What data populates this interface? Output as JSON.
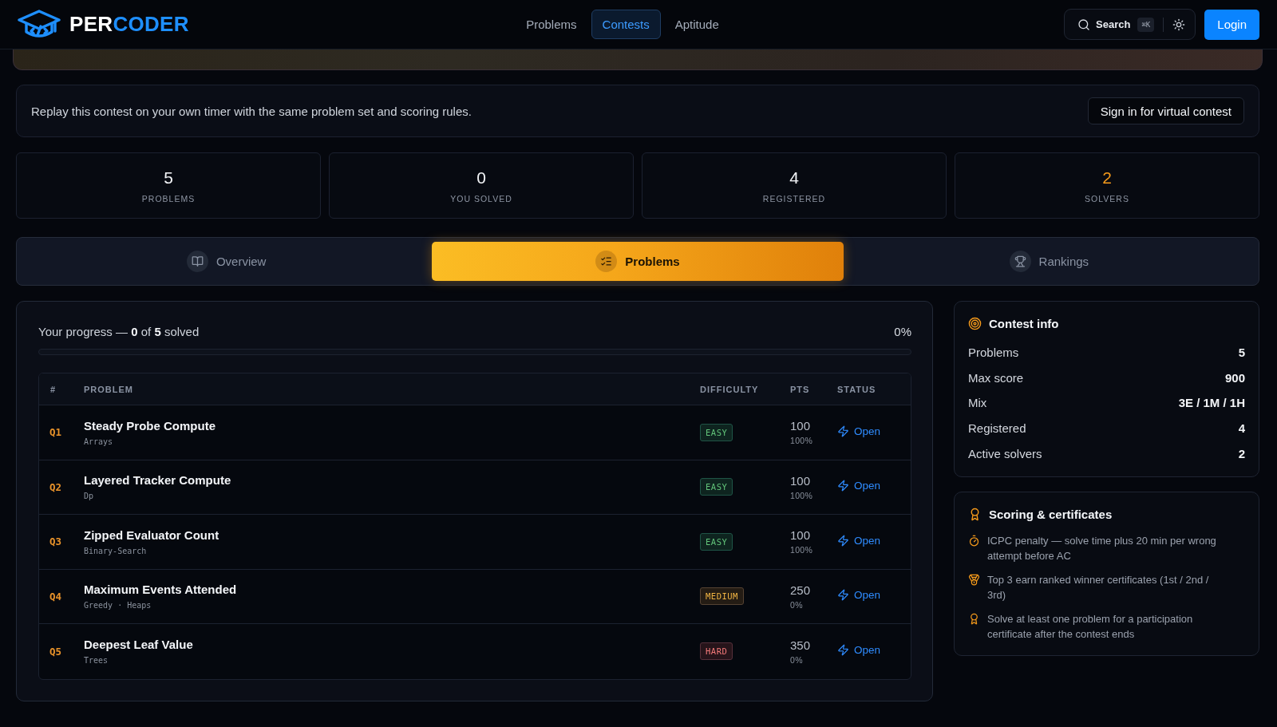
{
  "nav": {
    "logo": {
      "lead": "PER",
      "accent": "CODER"
    },
    "links": [
      {
        "label": "Problems",
        "selected": false
      },
      {
        "label": "Contests",
        "selected": true
      },
      {
        "label": "Aptitude",
        "selected": false
      }
    ],
    "search": {
      "label": "Search",
      "shortcut": "⌘K"
    },
    "login": "Login"
  },
  "virtual_contest": {
    "text": "Replay this contest on your own timer with the same problem set and scoring rules.",
    "button": "Sign in for virtual contest"
  },
  "stats": [
    {
      "value": "5",
      "label": "PROBLEMS",
      "highlighted": false
    },
    {
      "value": "0",
      "label": "YOU SOLVED",
      "highlighted": false
    },
    {
      "value": "4",
      "label": "REGISTERED",
      "highlighted": false
    },
    {
      "value": "2",
      "label": "SOLVERS",
      "highlighted": true
    }
  ],
  "tabs": [
    {
      "label": "Overview",
      "selected": false
    },
    {
      "label": "Problems",
      "selected": true
    },
    {
      "label": "Rankings",
      "selected": false
    }
  ],
  "progress": {
    "text": "Your progress — **0** of **5** solved",
    "percent": "0%"
  },
  "table": {
    "columns": [
      "#",
      "PROBLEM",
      "DIFFICULTY",
      "PTS",
      "STATUS"
    ],
    "rows": [
      {
        "id": "Q1",
        "title": "Steady Probe Compute",
        "tags": "Arrays",
        "difficulty": {
          "label": "EASY",
          "kind": "easy"
        },
        "points": "100",
        "rate": "100%",
        "status": "Open"
      },
      {
        "id": "Q2",
        "title": "Layered Tracker Compute",
        "tags": "Dp",
        "difficulty": {
          "label": "EASY",
          "kind": "easy"
        },
        "points": "100",
        "rate": "100%",
        "status": "Open"
      },
      {
        "id": "Q3",
        "title": "Zipped Evaluator Count",
        "tags": "Binary-Search",
        "difficulty": {
          "label": "EASY",
          "kind": "easy"
        },
        "points": "100",
        "rate": "100%",
        "status": "Open"
      },
      {
        "id": "Q4",
        "title": "Maximum Events Attended",
        "tags": "Greedy · Heaps",
        "difficulty": {
          "label": "MEDIUM",
          "kind": "medium"
        },
        "points": "250",
        "rate": "0%",
        "status": "Open"
      },
      {
        "id": "Q5",
        "title": "Deepest Leaf Value",
        "tags": "Trees",
        "difficulty": {
          "label": "HARD",
          "kind": "hard"
        },
        "points": "350",
        "rate": "0%",
        "status": "Open"
      }
    ]
  },
  "contest_info": {
    "title": "Contest info",
    "rows": [
      {
        "label": "Problems",
        "value": "5"
      },
      {
        "label": "Max score",
        "value": "900"
      },
      {
        "label": "Mix",
        "value": "3E / 1M / 1H"
      },
      {
        "label": "Registered",
        "value": "4"
      },
      {
        "label": "Active solvers",
        "value": "2"
      }
    ]
  },
  "scoring": {
    "title": "Scoring & certificates",
    "items": [
      "ICPC penalty — solve time plus 20 min per wrong attempt before AC",
      "Top 3 earn ranked winner certificates (1st / 2nd / 3rd)",
      "Solve at least one problem for a participation certificate after the contest ends"
    ]
  }
}
